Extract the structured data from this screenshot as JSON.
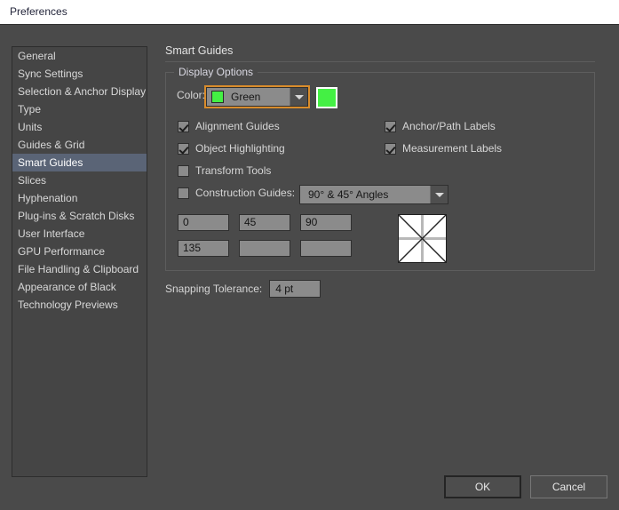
{
  "window": {
    "title": "Preferences"
  },
  "sidebar": {
    "items": [
      {
        "label": "General",
        "selected": false
      },
      {
        "label": "Sync Settings",
        "selected": false
      },
      {
        "label": "Selection & Anchor Display",
        "selected": false
      },
      {
        "label": "Type",
        "selected": false
      },
      {
        "label": "Units",
        "selected": false
      },
      {
        "label": "Guides & Grid",
        "selected": false
      },
      {
        "label": "Smart Guides",
        "selected": true
      },
      {
        "label": "Slices",
        "selected": false
      },
      {
        "label": "Hyphenation",
        "selected": false
      },
      {
        "label": "Plug-ins & Scratch Disks",
        "selected": false
      },
      {
        "label": "User Interface",
        "selected": false
      },
      {
        "label": "GPU Performance",
        "selected": false
      },
      {
        "label": "File Handling & Clipboard",
        "selected": false
      },
      {
        "label": "Appearance of Black",
        "selected": false
      },
      {
        "label": "Technology Previews",
        "selected": false
      }
    ]
  },
  "pane": {
    "title": "Smart Guides",
    "group": {
      "legend": "Display Options",
      "color": {
        "label": "Color:",
        "value": "Green",
        "swatch_hex": "#44f044",
        "focus_hex": "#d98c2b"
      },
      "checkboxes": {
        "alignment_guides": {
          "label": "Alignment Guides",
          "checked": true
        },
        "object_highlighting": {
          "label": "Object Highlighting",
          "checked": true
        },
        "transform_tools": {
          "label": "Transform Tools",
          "checked": false
        },
        "anchor_path_labels": {
          "label": "Anchor/Path Labels",
          "checked": true
        },
        "measurement_labels": {
          "label": "Measurement Labels",
          "checked": true
        },
        "construction_guides": {
          "label": "Construction Guides:",
          "checked": false
        }
      },
      "construction_guides_value": "90° & 45° Angles",
      "angles": [
        "0",
        "45",
        "90",
        "135",
        "",
        ""
      ]
    },
    "snapping": {
      "label": "Snapping Tolerance:",
      "value": "4 pt"
    }
  },
  "footer": {
    "ok": "OK",
    "cancel": "Cancel"
  }
}
